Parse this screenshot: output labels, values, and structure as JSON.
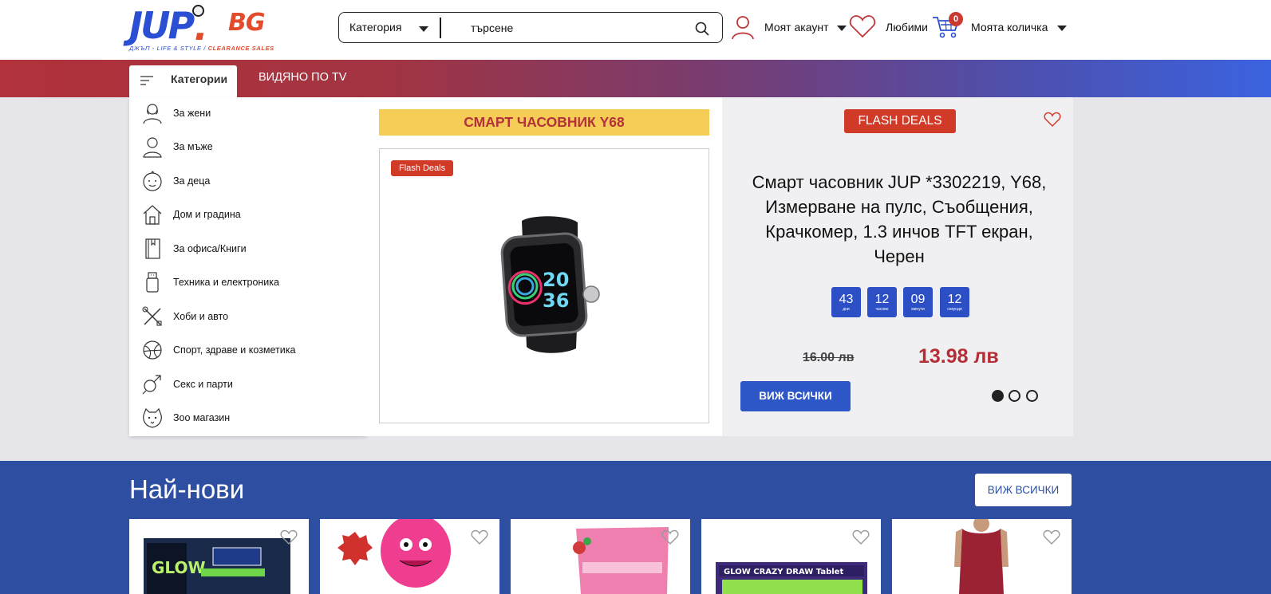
{
  "header": {
    "logo": {
      "text_main": "JUP",
      "text_dot": ".",
      "text_bg": "BG",
      "tagline_left": "ДЖЪП - LIFE & STYLE /",
      "tagline_right": "CLEARANCE SALES"
    },
    "search": {
      "category_label": "Категория",
      "placeholder": "търсене"
    },
    "account_label": "Моят акаунт",
    "favorites_label": "Любими",
    "cart_label": "Моята количка",
    "cart_count": "0"
  },
  "nav": {
    "categories_tab": "Категории",
    "tv_link": "ВИДЯНО ПО TV"
  },
  "sidebar": {
    "items": [
      {
        "label": "За жени",
        "icon": "woman-icon"
      },
      {
        "label": "За мъже",
        "icon": "man-icon"
      },
      {
        "label": "За деца",
        "icon": "baby-icon"
      },
      {
        "label": "Дом и градина",
        "icon": "house-icon"
      },
      {
        "label": "За офиса/Книги",
        "icon": "book-icon"
      },
      {
        "label": "Техника и електроника",
        "icon": "usb-icon"
      },
      {
        "label": "Хоби и авто",
        "icon": "tools-icon"
      },
      {
        "label": "Спорт, здраве и козметика",
        "icon": "ball-icon"
      },
      {
        "label": "Секс и парти",
        "icon": "gender-icon"
      },
      {
        "label": "Зоо магазин",
        "icon": "pet-icon"
      }
    ]
  },
  "promo": {
    "banner_title": "СМАРТ ЧАСОВНИК Y68",
    "card_tag": "Flash Deals"
  },
  "deal": {
    "badge": "FLASH DEALS",
    "title": "Смарт часовник JUP *3302219, Y68, Измерване на пулс, Съобщения, Крачкомер, 1.3 инчов TFT екран, Черен",
    "countdown": [
      {
        "value": "43",
        "unit": "дни"
      },
      {
        "value": "12",
        "unit": "часове"
      },
      {
        "value": "09",
        "unit": "минути"
      },
      {
        "value": "12",
        "unit": "секунди"
      }
    ],
    "old_price": "16.00 лв",
    "new_price": "13.98 лв",
    "view_all": "ВИЖ ВСИЧКИ",
    "slides": 3,
    "active_slide": 0
  },
  "newest": {
    "title": "Най-нови",
    "view_all": "ВИЖ ВСИЧКИ"
  },
  "colors": {
    "brand_blue": "#2a4fd3",
    "brand_red": "#d23a28",
    "price_red": "#b52e35",
    "section_blue": "#2e4fa1"
  }
}
